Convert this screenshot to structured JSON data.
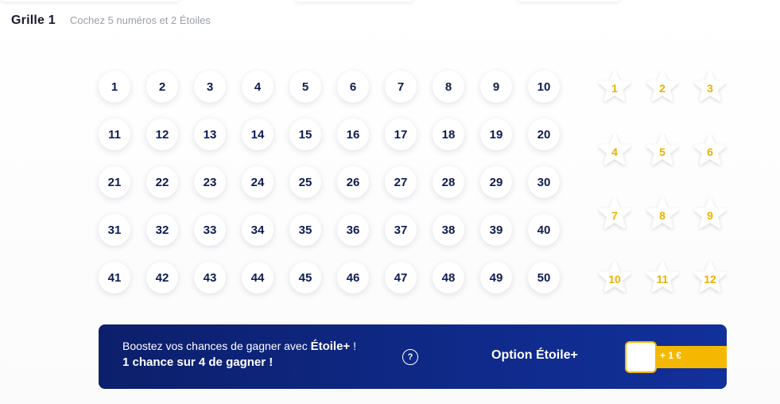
{
  "header": {
    "title": "Grille 1",
    "instruction": "Cochez 5 numéros et 2 Étoiles"
  },
  "numbers": [
    "1",
    "2",
    "3",
    "4",
    "5",
    "6",
    "7",
    "8",
    "9",
    "10",
    "11",
    "12",
    "13",
    "14",
    "15",
    "16",
    "17",
    "18",
    "19",
    "20",
    "21",
    "22",
    "23",
    "24",
    "25",
    "26",
    "27",
    "28",
    "29",
    "30",
    "31",
    "32",
    "33",
    "34",
    "35",
    "36",
    "37",
    "38",
    "39",
    "40",
    "41",
    "42",
    "43",
    "44",
    "45",
    "46",
    "47",
    "48",
    "49",
    "50"
  ],
  "stars": [
    "1",
    "2",
    "3",
    "4",
    "5",
    "6",
    "7",
    "8",
    "9",
    "10",
    "11",
    "12"
  ],
  "banner": {
    "line1_prefix": "Boostez vos chances de gagner avec ",
    "line1_brand": "Étoile+",
    "line1_suffix": " !",
    "line2": "1 chance sur 4 de gagner !",
    "help_icon": "question-mark-icon",
    "help_symbol": "?",
    "option_label": "Option Étoile+",
    "option_price": "+ 1 €"
  },
  "colors": {
    "number_text": "#0d1b52",
    "star_text": "#e8b100",
    "banner_bg": "#0f2a8a",
    "accent": "#f5b800"
  }
}
